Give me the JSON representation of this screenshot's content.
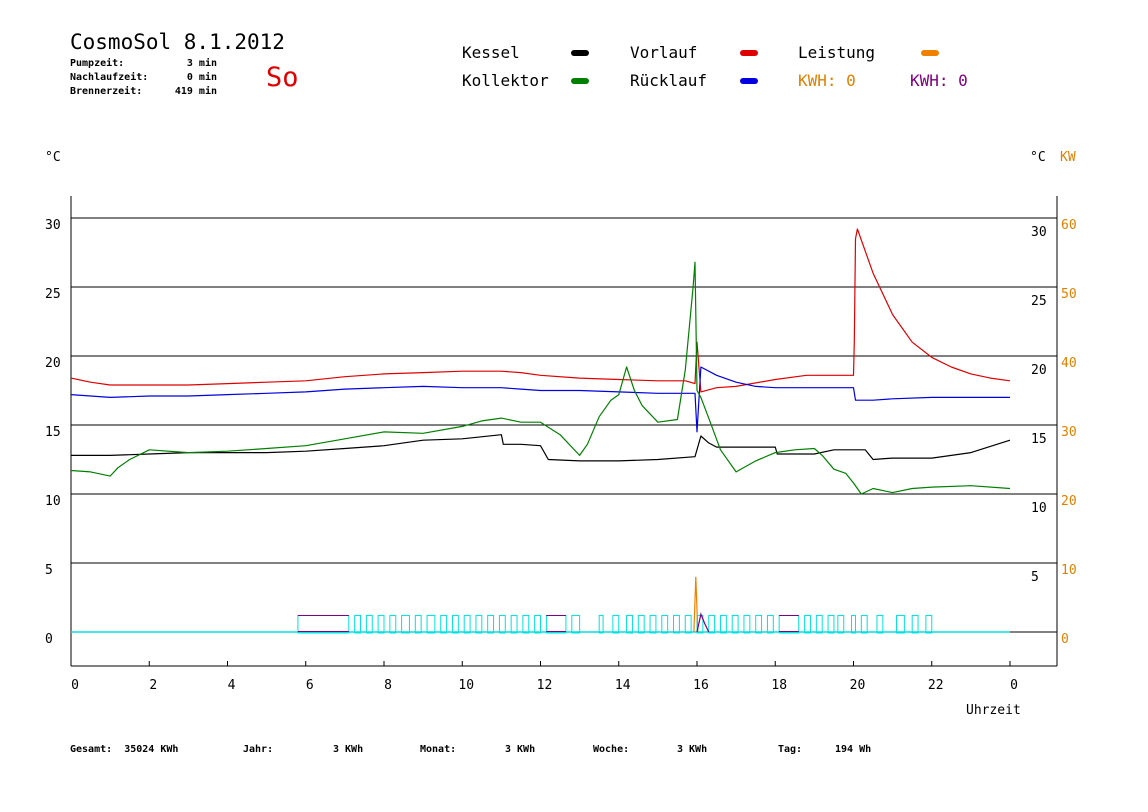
{
  "header": {
    "title": "CosmoSol 8.1.2012",
    "day": "So",
    "info": [
      {
        "label": "Pumpzeit:",
        "value": "3 min"
      },
      {
        "label": "Nachlaufzeit:",
        "value": "0 min"
      },
      {
        "label": "Brennerzeit:",
        "value": "419 min"
      }
    ]
  },
  "legend": {
    "kessel": "Kessel",
    "kollektor": "Kollektor",
    "vorlauf": "Vorlauf",
    "ruecklauf": "Rücklauf",
    "leistung": "Leistung",
    "kwh1": "KWH: 0",
    "kwh2": "KWH: 0"
  },
  "units": {
    "left": "°C",
    "right_c": "°C",
    "right_kw": "KW"
  },
  "footer": {
    "gesamt_label": "Gesamt:",
    "gesamt_value": "35024 KWh",
    "jahr_label": "Jahr:",
    "jahr_value": "3 KWh",
    "monat_label": "Monat:",
    "monat_value": "3 KWh",
    "woche_label": "Woche:",
    "woche_value": "3 KWh",
    "tag_label": "Tag:",
    "tag_value": "194 Wh"
  },
  "colors": {
    "kessel": "#000000",
    "kollektor": "#008000",
    "vorlauf": "#e00000",
    "ruecklauf": "#0000e0",
    "leistung": "#f08000",
    "kwh2": "#800080",
    "pump": "#00e0e0",
    "kw_axis": "#e08000"
  },
  "chart_data": {
    "type": "line",
    "xlabel": "Uhrzeit",
    "ylabel": "°C",
    "xlim": [
      0,
      24
    ],
    "ylim": [
      -2.5,
      32
    ],
    "y_right_kw_lim": [
      0,
      60
    ],
    "x_ticks": [
      "0",
      "2",
      "4",
      "6",
      "8",
      "10",
      "12",
      "14",
      "16",
      "18",
      "20",
      "22",
      "0"
    ],
    "x_tick_values": [
      0,
      2,
      4,
      6,
      8,
      10,
      12,
      14,
      16,
      18,
      20,
      22,
      24
    ],
    "y_left_ticks": [
      0,
      5,
      10,
      15,
      20,
      25,
      30
    ],
    "y_right_ticks": [
      5,
      10,
      15,
      20,
      25,
      30
    ],
    "y_right_kw_ticks": [
      0,
      10,
      20,
      30,
      40,
      50,
      60
    ],
    "grid_y": [
      0,
      5,
      10,
      15,
      20,
      25,
      30
    ],
    "series": [
      {
        "name": "Vorlauf",
        "color": "#e00000",
        "x": [
          0,
          0.5,
          1,
          2,
          3,
          4,
          5,
          6,
          7,
          8,
          9,
          10,
          11,
          11.5,
          12,
          13,
          14,
          15,
          15.7,
          15.95,
          16.0,
          16.1,
          16.5,
          17,
          18,
          18.8,
          19.5,
          20.0,
          20.02,
          20.05,
          20.1,
          20.5,
          21,
          21.5,
          22,
          22.5,
          23,
          23.5,
          24
        ],
        "y": [
          18.4,
          18.1,
          17.9,
          17.9,
          17.9,
          18.0,
          18.1,
          18.2,
          18.5,
          18.7,
          18.8,
          18.9,
          18.9,
          18.8,
          18.6,
          18.4,
          18.3,
          18.2,
          18.2,
          18.0,
          21.0,
          17.4,
          17.7,
          17.8,
          18.3,
          18.6,
          18.6,
          18.6,
          21.0,
          28.5,
          29.2,
          26.0,
          23.0,
          21.0,
          19.9,
          19.2,
          18.7,
          18.4,
          18.2
        ]
      },
      {
        "name": "Rücklauf",
        "color": "#0000e0",
        "x": [
          0,
          1,
          2,
          3,
          4,
          5,
          6,
          7,
          8,
          9,
          10,
          11,
          11.5,
          12,
          13,
          14,
          15,
          15.95,
          16.0,
          16.1,
          16.5,
          17,
          17.5,
          18,
          19,
          19.9,
          20.0,
          20.05,
          20.5,
          21,
          22,
          23,
          24
        ],
        "y": [
          17.2,
          17.0,
          17.1,
          17.1,
          17.2,
          17.3,
          17.4,
          17.6,
          17.7,
          17.8,
          17.7,
          17.7,
          17.6,
          17.5,
          17.5,
          17.4,
          17.3,
          17.3,
          14.5,
          19.2,
          18.6,
          18.1,
          17.8,
          17.7,
          17.7,
          17.7,
          17.7,
          16.8,
          16.8,
          16.9,
          17.0,
          17.0,
          17.0
        ]
      },
      {
        "name": "Kessel",
        "color": "#000000",
        "x": [
          0,
          1,
          2,
          3,
          4,
          5,
          6,
          7,
          8,
          9,
          10,
          11,
          11.05,
          11.5,
          12,
          12.2,
          13,
          14,
          15,
          15.95,
          16.1,
          16.3,
          16.5,
          17,
          18,
          18.05,
          19,
          19.5,
          20.3,
          20.5,
          21,
          22,
          23,
          24
        ],
        "y": [
          12.8,
          12.8,
          12.9,
          13.0,
          13.0,
          13.0,
          13.1,
          13.3,
          13.5,
          13.9,
          14.0,
          14.3,
          13.6,
          13.6,
          13.5,
          12.5,
          12.4,
          12.4,
          12.5,
          12.7,
          14.2,
          13.7,
          13.4,
          13.4,
          13.4,
          12.9,
          12.9,
          13.2,
          13.2,
          12.5,
          12.6,
          12.6,
          13.0,
          13.9
        ]
      },
      {
        "name": "Kollektor",
        "color": "#008000",
        "x": [
          0,
          0.5,
          1.0,
          1.2,
          1.5,
          2,
          3,
          4,
          5,
          6,
          7,
          8,
          9,
          10,
          10.5,
          11,
          11.5,
          12,
          12.5,
          13,
          13.2,
          13.5,
          13.8,
          14.0,
          14.2,
          14.4,
          14.6,
          15,
          15.5,
          15.7,
          15.9,
          15.95,
          16.0,
          16.1,
          16.3,
          16.6,
          17,
          17.5,
          18,
          18.5,
          19,
          19.2,
          19.5,
          19.8,
          20.0,
          20.2,
          20.5,
          21,
          21.5,
          22,
          23,
          24
        ],
        "y": [
          11.7,
          11.6,
          11.3,
          11.9,
          12.5,
          13.2,
          13.0,
          13.1,
          13.3,
          13.5,
          14.0,
          14.5,
          14.4,
          14.9,
          15.3,
          15.5,
          15.2,
          15.2,
          14.3,
          12.8,
          13.6,
          15.6,
          16.8,
          17.2,
          19.2,
          17.5,
          16.4,
          15.2,
          15.4,
          19.0,
          25.0,
          26.8,
          17.5,
          17.0,
          15.5,
          13.2,
          11.6,
          12.4,
          13.0,
          13.2,
          13.3,
          12.8,
          11.8,
          11.5,
          10.8,
          10.0,
          10.4,
          10.1,
          10.4,
          10.5,
          10.6,
          10.4
        ]
      }
    ],
    "leistung_kw": {
      "x": [
        15.92,
        15.97,
        16.02
      ],
      "y": [
        0,
        8,
        0
      ]
    },
    "kwh_curve": {
      "x": [
        16.0,
        16.1,
        16.2,
        16.3
      ],
      "y": [
        0,
        1.3,
        0.6,
        0
      ]
    },
    "pump_segments": [
      [
        5.8,
        7.1
      ],
      [
        7.25,
        7.4
      ],
      [
        7.55,
        7.7
      ],
      [
        7.85,
        8.0
      ],
      [
        8.15,
        8.3
      ],
      [
        8.45,
        8.65
      ],
      [
        8.8,
        8.95
      ],
      [
        9.1,
        9.3
      ],
      [
        9.45,
        9.6
      ],
      [
        9.75,
        9.9
      ],
      [
        10.05,
        10.2
      ],
      [
        10.35,
        10.5
      ],
      [
        10.65,
        10.8
      ],
      [
        10.95,
        11.1
      ],
      [
        11.25,
        11.4
      ],
      [
        11.55,
        11.7
      ],
      [
        11.85,
        12.0
      ],
      [
        12.15,
        12.65
      ],
      [
        12.8,
        13.0
      ],
      [
        13.5,
        13.6
      ],
      [
        13.85,
        14.0
      ],
      [
        14.2,
        14.35
      ],
      [
        14.5,
        14.65
      ],
      [
        14.8,
        14.95
      ],
      [
        15.1,
        15.25
      ],
      [
        15.4,
        15.55
      ],
      [
        15.7,
        15.85
      ],
      [
        16.0,
        16.15
      ],
      [
        16.3,
        16.45
      ],
      [
        16.6,
        16.75
      ],
      [
        16.9,
        17.05
      ],
      [
        17.2,
        17.35
      ],
      [
        17.5,
        17.65
      ],
      [
        17.8,
        17.95
      ],
      [
        18.1,
        18.6
      ],
      [
        18.75,
        18.9
      ],
      [
        19.05,
        19.2
      ],
      [
        19.35,
        19.5
      ],
      [
        19.6,
        19.75
      ],
      [
        19.95,
        20.05
      ],
      [
        20.2,
        20.35
      ],
      [
        20.6,
        20.75
      ],
      [
        21.1,
        21.3
      ],
      [
        21.5,
        21.65
      ],
      [
        21.85,
        22.0
      ]
    ],
    "pump_purple_segments": [
      [
        5.8,
        7.1
      ],
      [
        12.15,
        12.65
      ],
      [
        18.1,
        18.6
      ]
    ],
    "pump_level": 0,
    "pump_height": 1.2
  }
}
